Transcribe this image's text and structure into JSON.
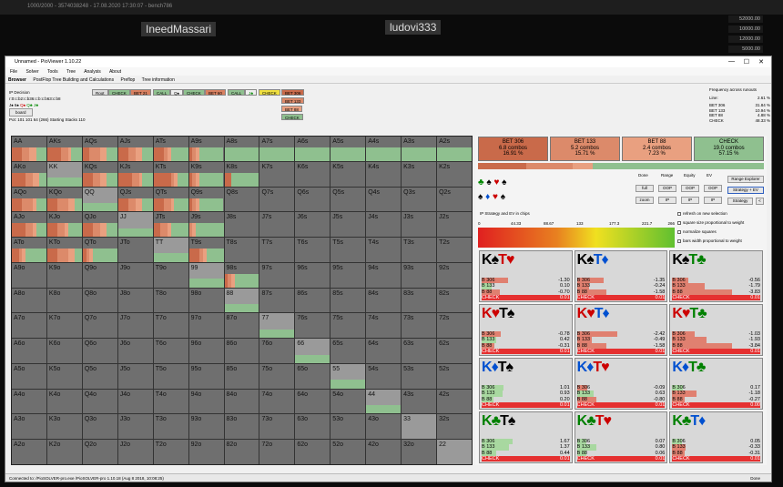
{
  "bg": {
    "top_text": "1000/2000 - 3574038248 - 17.08.2020 17:30:07 - bench786",
    "players": [
      "IneedMassari",
      "ludovi333"
    ],
    "stacks": [
      "52000.00",
      "10000.00",
      "12000.00",
      "5000.00"
    ]
  },
  "window": {
    "title": "Unnamed - PioViewer 1.10.22",
    "minimize": "—",
    "maximize": "☐",
    "close": "✕"
  },
  "menu": [
    "File",
    "Solver",
    "Tools",
    "Tree",
    "Analysis",
    "About"
  ],
  "tabs": [
    "Browser",
    "PostFlop Tree Building and Calculations",
    "Preflop",
    "Tree information"
  ],
  "info": {
    "ip_decision": "IP Decision",
    "line": "r:0:c:b2:c:b36:c:b:c:b63:c:b8",
    "cards": [
      "J♠",
      "6♠",
      "Q♠",
      "Q♣",
      "J♣"
    ],
    "board_btn": "board",
    "pot_line": "Pot: 101 101 64 (266) Starting Stacks 110"
  },
  "tree_nodes": [
    "Root",
    "CHECK",
    "BET 21",
    "CALL",
    "Q♠",
    "CHECK",
    "BET 60",
    "CALL",
    "J♣",
    "CHECK",
    "BET 306",
    "BET 133",
    "BET 88",
    "CHECK"
  ],
  "freq": {
    "title": "Frequency across runouts",
    "line_label": "Line:",
    "line_value": "2.61 %",
    "rows": [
      {
        "name": "BET 306",
        "value": "31.84 %"
      },
      {
        "name": "BET 133",
        "value": "10.94 %"
      },
      {
        "name": "BET 88",
        "value": "4.88 %"
      },
      {
        "name": "CHECK",
        "value": "48.33 %"
      }
    ]
  },
  "colors": {
    "bet306": "#c96a4a",
    "bet133": "#dc8a6a",
    "bet88": "#e9a080",
    "check": "#8fc08f",
    "grid_bg": "#6f6f6f"
  },
  "grid": [
    [
      "AA",
      "AKs",
      "AQs",
      "AJs",
      "ATs",
      "A9s",
      "A8s",
      "A7s",
      "A6s",
      "A5s",
      "A4s",
      "A3s",
      "A2s"
    ],
    [
      "AKo",
      "KK",
      "KQs",
      "KJs",
      "KTs",
      "K9s",
      "K8s",
      "K7s",
      "K6s",
      "K5s",
      "K4s",
      "K3s",
      "K2s"
    ],
    [
      "AQo",
      "KQo",
      "QQ",
      "QJs",
      "QTs",
      "Q9s",
      "Q8s",
      "Q7s",
      "Q6s",
      "Q5s",
      "Q4s",
      "Q3s",
      "Q2s"
    ],
    [
      "AJo",
      "KJo",
      "QJo",
      "JJ",
      "JTs",
      "J9s",
      "J8s",
      "J7s",
      "J6s",
      "J5s",
      "J4s",
      "J3s",
      "J2s"
    ],
    [
      "ATo",
      "KTo",
      "QTo",
      "JTo",
      "TT",
      "T9s",
      "T8s",
      "T7s",
      "T6s",
      "T5s",
      "T4s",
      "T3s",
      "T2s"
    ],
    [
      "A9o",
      "K9o",
      "Q9o",
      "J9o",
      "T9o",
      "99",
      "98s",
      "97s",
      "96s",
      "95s",
      "94s",
      "93s",
      "92s"
    ],
    [
      "A8o",
      "K8o",
      "Q8o",
      "J8o",
      "T8o",
      "98o",
      "88",
      "87s",
      "86s",
      "85s",
      "84s",
      "83s",
      "82s"
    ],
    [
      "A7o",
      "K7o",
      "Q7o",
      "J7o",
      "T7o",
      "97o",
      "87o",
      "77",
      "76s",
      "75s",
      "74s",
      "73s",
      "72s"
    ],
    [
      "A6o",
      "K6o",
      "Q6o",
      "J6o",
      "T6o",
      "96o",
      "86o",
      "76o",
      "66",
      "65s",
      "64s",
      "63s",
      "62s"
    ],
    [
      "A5o",
      "K5o",
      "Q5o",
      "J5o",
      "T5o",
      "95o",
      "85o",
      "75o",
      "65o",
      "55",
      "54s",
      "53s",
      "52s"
    ],
    [
      "A4o",
      "K4o",
      "Q4o",
      "J4o",
      "T4o",
      "94o",
      "84o",
      "74o",
      "64o",
      "54o",
      "44",
      "43s",
      "42s"
    ],
    [
      "A3o",
      "K3o",
      "Q3o",
      "J3o",
      "T3o",
      "93o",
      "83o",
      "73o",
      "63o",
      "53o",
      "43o",
      "33",
      "32s"
    ],
    [
      "A2o",
      "K2o",
      "Q2o",
      "J2o",
      "T2o",
      "92o",
      "82o",
      "72o",
      "62o",
      "52o",
      "42o",
      "32o",
      "22"
    ]
  ],
  "actions": [
    {
      "name": "BET 306",
      "combos": "6.8 combos",
      "pct": "16.91 %",
      "color": "#c96a4a"
    },
    {
      "name": "BET 133",
      "combos": "5.2 combos",
      "pct": "15.71 %",
      "color": "#dc8a6a"
    },
    {
      "name": "BET 88",
      "combos": "2.4 combos",
      "pct": "7.23 %",
      "color": "#e9a080"
    },
    {
      "name": "CHECK",
      "combos": "19.0 combos",
      "pct": "57.15 %",
      "color": "#8fc08f"
    }
  ],
  "controls": {
    "suits_top": [
      "♣",
      "♠",
      "♥",
      "♠"
    ],
    "suits_bottom": [
      "♠",
      "♦",
      "♥",
      "♠"
    ],
    "headers": [
      "Done",
      "Range",
      "Equity",
      "EV"
    ],
    "buttons": [
      "full",
      "OOP",
      "OOP",
      "OOP",
      "zoom",
      "IP",
      "IP",
      "IP"
    ],
    "range_explorer": "Range Explorer",
    "strategy_ev": "Strategy + EV",
    "strategy": "Strategy",
    "ev_label": "IP Strategy and EV in chips",
    "ticks": [
      "0",
      "44.33",
      "88.67",
      "133",
      "177.3",
      "221.7",
      "266"
    ],
    "checks": [
      "refresh on new selection",
      "square size proportional to weight",
      "normalize squares",
      "bars width proportional to weight"
    ]
  },
  "combos": [
    {
      "cards": [
        [
          "K",
          "♠",
          "#000"
        ],
        [
          "T",
          "♥",
          "#c00"
        ]
      ],
      "rows": [
        [
          "B 306",
          "-1.30"
        ],
        [
          "B 133",
          "0.10"
        ],
        [
          "B 88",
          "-0.70"
        ],
        [
          "CHECK",
          "0.01"
        ]
      ]
    },
    {
      "cards": [
        [
          "K",
          "♠",
          "#000"
        ],
        [
          "T",
          "♦",
          "#0050d0"
        ]
      ],
      "rows": [
        [
          "B 306",
          "-1.35"
        ],
        [
          "B 133",
          "-0.24"
        ],
        [
          "B 88",
          "-1.58"
        ],
        [
          "CHECK",
          "0.01"
        ]
      ]
    },
    {
      "cards": [
        [
          "K",
          "♠",
          "#000"
        ],
        [
          "T",
          "♣",
          "#008000"
        ]
      ],
      "rows": [
        [
          "B 306",
          "-0.56"
        ],
        [
          "B 133",
          "-1.79"
        ],
        [
          "B 88",
          "-3.83"
        ],
        [
          "CHECK",
          "0.01"
        ]
      ]
    },
    {
      "cards": [
        [
          "K",
          "♥",
          "#c00"
        ],
        [
          "T",
          "♠",
          "#000"
        ]
      ],
      "rows": [
        [
          "B 306",
          "-0.78"
        ],
        [
          "B 133",
          "0.42"
        ],
        [
          "B 88",
          "-0.31"
        ],
        [
          "CHECK",
          "0.01"
        ]
      ]
    },
    {
      "cards": [
        [
          "K",
          "♥",
          "#c00"
        ],
        [
          "T",
          "♦",
          "#0050d0"
        ]
      ],
      "rows": [
        [
          "B 306",
          "-2.42"
        ],
        [
          "B 133",
          "-0.49"
        ],
        [
          "B 88",
          "-1.58"
        ],
        [
          "CHECK",
          "0.01"
        ]
      ]
    },
    {
      "cards": [
        [
          "K",
          "♥",
          "#c00"
        ],
        [
          "T",
          "♣",
          "#008000"
        ]
      ],
      "rows": [
        [
          "B 306",
          "-1.03"
        ],
        [
          "B 133",
          "-1.93"
        ],
        [
          "B 88",
          "-3.84"
        ],
        [
          "CHECK",
          "0.01"
        ]
      ]
    },
    {
      "cards": [
        [
          "K",
          "♦",
          "#0050d0"
        ],
        [
          "T",
          "♠",
          "#000"
        ]
      ],
      "rows": [
        [
          "B 306",
          "1.01"
        ],
        [
          "B 133",
          "0.93"
        ],
        [
          "B 88",
          "0.20"
        ],
        [
          "CHECK",
          "0.01"
        ]
      ]
    },
    {
      "cards": [
        [
          "K",
          "♦",
          "#0050d0"
        ],
        [
          "T",
          "♥",
          "#c00"
        ]
      ],
      "rows": [
        [
          "B 306",
          "-0.09"
        ],
        [
          "B 133",
          "0.63"
        ],
        [
          "B 88",
          "-0.80"
        ],
        [
          "CHECK",
          "0.01"
        ]
      ]
    },
    {
      "cards": [
        [
          "K",
          "♦",
          "#0050d0"
        ],
        [
          "T",
          "♣",
          "#008000"
        ]
      ],
      "rows": [
        [
          "B 306",
          "0.17"
        ],
        [
          "B 133",
          "-1.18"
        ],
        [
          "B 88",
          "-0.27"
        ],
        [
          "CHECK",
          "0.00"
        ]
      ]
    },
    {
      "cards": [
        [
          "K",
          "♣",
          "#008000"
        ],
        [
          "T",
          "♠",
          "#000"
        ]
      ],
      "rows": [
        [
          "B 306",
          "1.67"
        ],
        [
          "B 133",
          "1.37"
        ],
        [
          "B 88",
          "0.44"
        ],
        [
          "CHECK",
          "0.01"
        ]
      ]
    },
    {
      "cards": [
        [
          "K",
          "♣",
          "#008000"
        ],
        [
          "T",
          "♥",
          "#c00"
        ]
      ],
      "rows": [
        [
          "B 306",
          "0.07"
        ],
        [
          "B 133",
          "0.80"
        ],
        [
          "B 88",
          "0.06"
        ],
        [
          "CHECK",
          "0.01"
        ]
      ]
    },
    {
      "cards": [
        [
          "K",
          "♣",
          "#008000"
        ],
        [
          "T",
          "♦",
          "#0050d0"
        ]
      ],
      "rows": [
        [
          "B 306",
          "0.05"
        ],
        [
          "B 133",
          "-0.33"
        ],
        [
          "B 88",
          "-0.31"
        ],
        [
          "CHECK",
          "0.01"
        ]
      ]
    }
  ],
  "status": {
    "left": "Connected to: /PioSOLVER-pro.exe /PioSOLVER-pro 1.10.18 (Aug  8 2018, 10:08:25)",
    "right": "Done"
  }
}
